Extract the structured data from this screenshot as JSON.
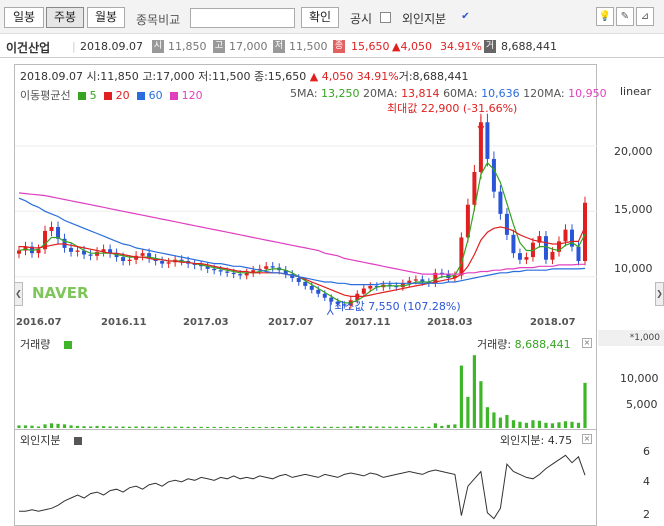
{
  "toolbar": {
    "daily": "일봉",
    "weekly": "주봉",
    "monthly": "월봉",
    "compare_label": "종목비교",
    "confirm": "확인",
    "disclosure": "공시",
    "foreign": "외인지분"
  },
  "info": {
    "name": "이건산업",
    "date": "2018.09.07",
    "open": "11,850",
    "high": "17,000",
    "low": "11,500",
    "close": "15,650",
    "change": "▲4,050",
    "pct": "34.91%",
    "volume": "8,688,441",
    "b_open": "시",
    "b_high": "고",
    "b_low": "저",
    "b_close": "종",
    "b_vol": "거"
  },
  "ohlc": {
    "date": "2018.09.07",
    "open": "시:11,850",
    "high": "고:17,000",
    "low": "저:11,500",
    "close": "종:15,650",
    "change": "▲ 4,050",
    "pct": "34.91%",
    "volume": "거:8,688,441"
  },
  "legend": {
    "title": "이동평균선",
    "p5": "5",
    "p20": "20",
    "p60": "60",
    "p120": "120"
  },
  "ma": {
    "l5": "5MA:",
    "v5": "13,250",
    "l20": "20MA:",
    "v20": "13,814",
    "l60": "60MA:",
    "v60": "10,636",
    "l120": "120MA:",
    "v120": "10,950"
  },
  "scale": "linear",
  "watermark": "NAVER",
  "annotations": {
    "max": "최대값 22,900 (-31.66%)",
    "min": "최소값 7,550 (107.28%)"
  },
  "volume_panel": {
    "title": "거래량",
    "label": "거래량:",
    "value": "8,688,441",
    "unit": "*1,000"
  },
  "foreign_panel": {
    "title": "외인지분",
    "label": "외인지분:",
    "value": "4.75"
  },
  "colors": {
    "ma5": "#36a321",
    "ma20": "#e02020",
    "ma60": "#2a6edc",
    "ma120": "#e040c0",
    "up": "#e02020",
    "down": "#2a55d8",
    "volume": "#3fb52a"
  },
  "chart_data": [
    {
      "type": "candlestick",
      "x_ticks": [
        "2016.07",
        "2016.11",
        "2017.03",
        "2017.07",
        "2017.11",
        "2018.03",
        "2018.07"
      ],
      "y_ticks": [
        10000,
        15000,
        20000
      ],
      "ylim": [
        7000,
        23500
      ],
      "close_series": [
        12000,
        12300,
        11800,
        12100,
        13500,
        13800,
        12900,
        12200,
        11900,
        12000,
        11700,
        11600,
        11900,
        12100,
        11800,
        11500,
        11200,
        11300,
        11600,
        11800,
        11400,
        11200,
        11000,
        11100,
        11300,
        11200,
        11000,
        10900,
        10800,
        10600,
        10500,
        10400,
        10300,
        10200,
        10100,
        10300,
        10500,
        10600,
        10800,
        10700,
        10500,
        10200,
        9900,
        9600,
        9300,
        9000,
        8700,
        8400,
        8100,
        7900,
        7800,
        8200,
        8700,
        9100,
        9300,
        9200,
        9400,
        9300,
        9200,
        9500,
        9700,
        9800,
        9600,
        9500,
        10300,
        10200,
        9900,
        10100,
        13000,
        15500,
        18000,
        21800,
        19000,
        16500,
        14800,
        13200,
        11800,
        11300,
        11500,
        12600,
        13100,
        11300,
        11900,
        12700,
        13600,
        12300,
        11200,
        15650
      ],
      "ma": {
        "5": [
          12000,
          12100,
          12000,
          12100,
          12500,
          13000,
          13000,
          12700,
          12600,
          12300,
          12000,
          11800,
          11800,
          11800,
          11800,
          11700,
          11600,
          11500,
          11500,
          11500,
          11500,
          11400,
          11300,
          11200,
          11200,
          11200,
          11100,
          11000,
          10900,
          10800,
          10700,
          10600,
          10500,
          10400,
          10300,
          10300,
          10300,
          10400,
          10500,
          10600,
          10600,
          10500,
          10300,
          10000,
          9700,
          9400,
          9100,
          8800,
          8500,
          8200,
          8000,
          8000,
          8200,
          8500,
          8900,
          9200,
          9300,
          9300,
          9300,
          9300,
          9400,
          9600,
          9600,
          9600,
          9800,
          10000,
          10000,
          10100,
          11000,
          12800,
          15200,
          17800,
          18700,
          18200,
          17200,
          15600,
          14000,
          12600,
          12000,
          12000,
          12300,
          12300,
          12100,
          12000,
          12400,
          12600,
          12300,
          13250
        ],
        "20": [
          12300,
          12300,
          12200,
          12200,
          12300,
          12400,
          12500,
          12500,
          12400,
          12300,
          12200,
          12100,
          12000,
          11900,
          11800,
          11800,
          11700,
          11600,
          11500,
          11500,
          11400,
          11300,
          11300,
          11200,
          11200,
          11100,
          11100,
          11000,
          11000,
          10900,
          10800,
          10700,
          10600,
          10500,
          10400,
          10400,
          10300,
          10300,
          10300,
          10300,
          10300,
          10200,
          10100,
          10000,
          9800,
          9600,
          9400,
          9200,
          9000,
          8800,
          8600,
          8500,
          8500,
          8500,
          8600,
          8700,
          8800,
          8900,
          9000,
          9100,
          9200,
          9300,
          9400,
          9500,
          9600,
          9700,
          9800,
          9900,
          10200,
          10800,
          11700,
          12800,
          13400,
          13700,
          13800,
          13700,
          13500,
          13200,
          13000,
          12800,
          12700,
          12600,
          12500,
          12500,
          12600,
          12700,
          12700,
          13814
        ],
        "60": [
          16000,
          15800,
          15500,
          15300,
          15000,
          14800,
          14600,
          14300,
          14100,
          13900,
          13700,
          13500,
          13300,
          13100,
          12900,
          12700,
          12500,
          12400,
          12200,
          12100,
          12000,
          11900,
          11800,
          11700,
          11600,
          11500,
          11400,
          11300,
          11200,
          11100,
          11000,
          11000,
          10900,
          10800,
          10800,
          10700,
          10600,
          10500,
          10400,
          10300,
          10300,
          10200,
          10100,
          10000,
          9900,
          9800,
          9700,
          9600,
          9600,
          9500,
          9500,
          9400,
          9400,
          9400,
          9400,
          9400,
          9500,
          9500,
          9500,
          9500,
          9500,
          9500,
          9500,
          9500,
          9500,
          9500,
          9600,
          9600,
          9700,
          9800,
          9900,
          10000,
          10100,
          10200,
          10300,
          10300,
          10400,
          10400,
          10500,
          10500,
          10500,
          10500,
          10600,
          10600,
          10600,
          10600,
          10600,
          10636
        ],
        "120": [
          16400,
          16350,
          16300,
          16250,
          16200,
          16100,
          16000,
          15900,
          15800,
          15700,
          15600,
          15500,
          15400,
          15300,
          15200,
          15100,
          15000,
          14900,
          14800,
          14700,
          14600,
          14500,
          14400,
          14300,
          14200,
          14100,
          14000,
          13900,
          13800,
          13700,
          13600,
          13500,
          13400,
          13300,
          13200,
          13100,
          13000,
          12900,
          12800,
          12700,
          12600,
          12500,
          12400,
          12300,
          12200,
          12100,
          12000,
          11800,
          11700,
          11600,
          11400,
          11300,
          11200,
          11100,
          11000,
          10900,
          10800,
          10700,
          10600,
          10500,
          10400,
          10300,
          10200,
          10200,
          10200,
          10200,
          10200,
          10200,
          10200,
          10300,
          10300,
          10400,
          10400,
          10500,
          10500,
          10600,
          10600,
          10700,
          10700,
          10700,
          10800,
          10800,
          10800,
          10900,
          10900,
          10900,
          10950,
          10950
        ]
      },
      "max_annotation": 22900,
      "min_annotation": 7550
    },
    {
      "type": "bar",
      "name": "거래량",
      "y_ticks": [
        5000,
        10000
      ],
      "ylim": [
        0,
        15000
      ],
      "values": [
        500,
        500,
        450,
        300,
        700,
        900,
        800,
        700,
        500,
        400,
        350,
        300,
        400,
        350,
        300,
        300,
        280,
        250,
        300,
        280,
        260,
        250,
        250,
        240,
        260,
        240,
        230,
        220,
        220,
        210,
        220,
        200,
        210,
        200,
        190,
        200,
        210,
        200,
        220,
        210,
        200,
        220,
        240,
        260,
        250,
        270,
        250,
        240,
        230,
        220,
        250,
        300,
        350,
        320,
        300,
        280,
        260,
        250,
        260,
        250,
        240,
        250,
        240,
        230,
        900,
        400,
        600,
        700,
        12000,
        6000,
        14000,
        9000,
        4000,
        3000,
        2000,
        2500,
        1500,
        1200,
        1000,
        1500,
        1400,
        1000,
        900,
        1100,
        1300,
        1200,
        1000,
        8688
      ]
    },
    {
      "type": "line",
      "name": "외인지분",
      "y_ticks": [
        2,
        4,
        6
      ],
      "ylim": [
        1.5,
        6.8
      ],
      "values": [
        2.3,
        2.3,
        2.4,
        2.3,
        2.4,
        2.5,
        2.7,
        3.0,
        3.2,
        3.4,
        3.2,
        3.5,
        3.6,
        3.4,
        3.7,
        3.8,
        3.6,
        3.9,
        4.0,
        3.8,
        4.1,
        4.2,
        4.0,
        4.3,
        4.4,
        4.3,
        4.5,
        4.4,
        4.6,
        4.5,
        4.4,
        4.6,
        4.5,
        4.7,
        4.5,
        4.6,
        4.5,
        4.7,
        4.6,
        4.5,
        4.7,
        4.8,
        4.6,
        4.7,
        4.8,
        4.7,
        4.6,
        4.8,
        4.7,
        4.6,
        4.8,
        4.9,
        4.8,
        4.7,
        4.9,
        4.8,
        4.6,
        4.7,
        4.8,
        4.9,
        5.0,
        4.9,
        4.8,
        5.0,
        5.1,
        5.0,
        4.9,
        4.8,
        2.0,
        4.0,
        4.5,
        5.0,
        2.2,
        1.8,
        2.5,
        5.5,
        5.0,
        4.8,
        4.6,
        4.5,
        4.8,
        5.2,
        5.5,
        5.8,
        6.1,
        5.6,
        6.0,
        4.75
      ]
    }
  ]
}
